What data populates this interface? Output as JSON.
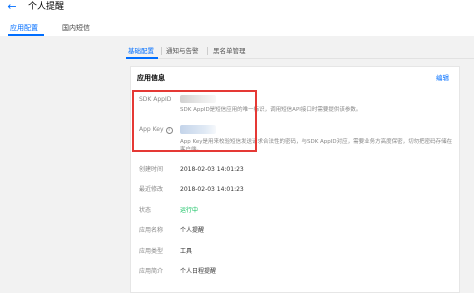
{
  "header": {
    "back_icon": "arrow-left-icon",
    "title": "个人提醒"
  },
  "top_tabs": [
    {
      "label": "应用配置",
      "active": true
    },
    {
      "label": "国内短信",
      "active": false
    }
  ],
  "sub_tabs": [
    {
      "label": "基础配置",
      "active": true
    },
    {
      "label": "通知与告警",
      "active": false
    },
    {
      "label": "黑名单管理",
      "active": false
    }
  ],
  "card": {
    "title": "应用信息",
    "edit_label": "编辑",
    "fields": {
      "sdk_appid": {
        "label": "SDK AppID",
        "hint": "SDK AppID是短信应用的唯一标识，调用短信API接口时需要提供该参数。"
      },
      "app_key": {
        "label": "App Key",
        "hint": "App Key是用来校验短信发送请求合法性的密码，与SDK AppID对应，需要业务方高度保密，切勿把密码存储在客户端。"
      },
      "created_at": {
        "label": "创建时间",
        "value": "2018-02-03 14:01:23"
      },
      "modified_at": {
        "label": "最近修改",
        "value": "2018-02-03 14:01:23"
      },
      "status": {
        "label": "状态",
        "value": "运行中"
      },
      "app_name": {
        "label": "应用名称",
        "value": "个人提醒"
      },
      "app_type": {
        "label": "应用类型",
        "value": "工具"
      },
      "app_intro": {
        "label": "应用简介",
        "value": "个人日程提醒"
      }
    }
  },
  "colors": {
    "accent": "#006eff",
    "status_green": "#0abf5b",
    "highlight_red": "#e53935"
  }
}
